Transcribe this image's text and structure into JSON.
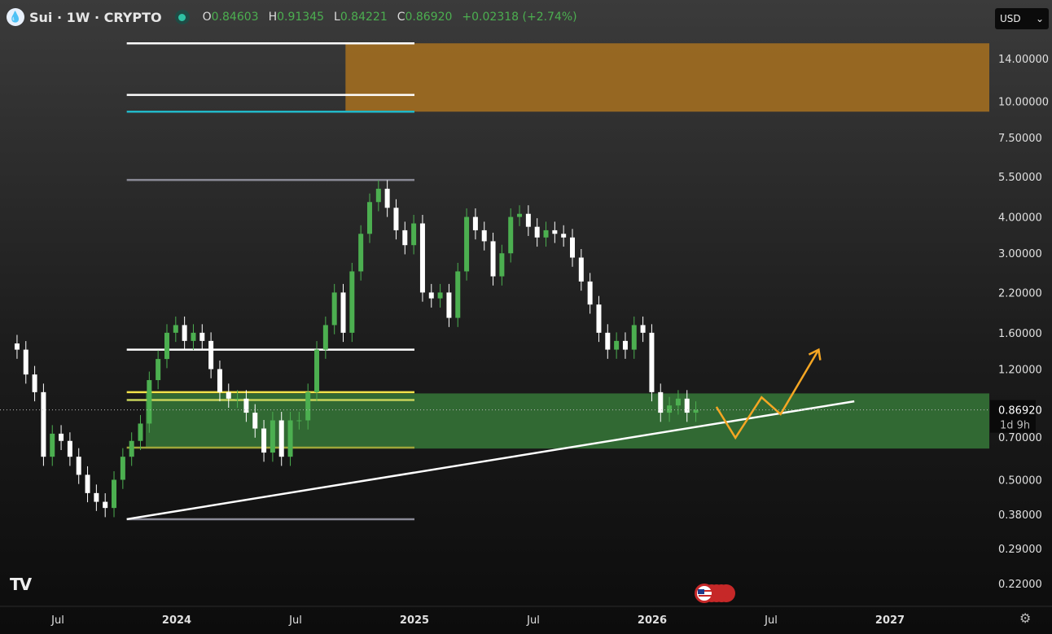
{
  "header": {
    "symbol": "Sui · 1W · CRYPTO",
    "o_label": "O",
    "o": "0.84603",
    "h_label": "H",
    "h": "0.91345",
    "l_label": "L",
    "l": "0.84221",
    "c_label": "C",
    "c": "0.86920",
    "change": "+0.02318 (+2.74%)"
  },
  "currency": {
    "label": "USD",
    "chevron": "⌄"
  },
  "price_label": {
    "value": "0.86920",
    "countdown": "1d 9h"
  },
  "colors": {
    "up": "#4caf50",
    "down": "#ffffff",
    "orange_zone": "#9c6a22",
    "green_zone": "#336e35",
    "projection": "#f5a623"
  },
  "chart_data": {
    "type": "candlestick",
    "scale": "log",
    "start": "2023-05-01",
    "end": "2026-03-09",
    "closes": [
      1.4,
      1.15,
      1.0,
      0.6,
      0.72,
      0.68,
      0.6,
      0.52,
      0.45,
      0.42,
      0.4,
      0.5,
      0.6,
      0.68,
      0.78,
      1.1,
      1.3,
      1.6,
      1.7,
      1.5,
      1.6,
      1.5,
      1.2,
      1.0,
      0.95,
      0.95,
      0.85,
      0.75,
      0.62,
      0.8,
      0.6,
      0.8,
      0.8,
      1.0,
      1.4,
      1.7,
      2.2,
      1.6,
      2.6,
      3.5,
      4.5,
      5.0,
      4.3,
      3.6,
      3.2,
      3.8,
      2.2,
      2.1,
      2.2,
      1.8,
      2.6,
      4.0,
      3.6,
      3.3,
      2.5,
      3.0,
      4.0,
      4.1,
      3.7,
      3.4,
      3.6,
      3.5,
      3.4,
      2.9,
      2.4,
      2.0,
      1.6,
      1.4,
      1.5,
      1.4,
      1.7,
      1.6,
      1.0,
      0.85,
      0.9,
      0.95,
      0.85,
      0.8692
    ],
    "y_ticks": [
      "14.00000",
      "10.00000",
      "7.50000",
      "5.50000",
      "4.00000",
      "3.00000",
      "2.20000",
      "1.60000",
      "1.20000",
      "0.70000",
      "0.50000",
      "0.38000",
      "0.29000",
      "0.22000"
    ],
    "x_ticks": [
      {
        "label": "Jul",
        "t": 2023.5
      },
      {
        "label": "2024",
        "t": 2024.0
      },
      {
        "label": "Jul",
        "t": 2024.5
      },
      {
        "label": "2025",
        "t": 2025.0
      },
      {
        "label": "Jul",
        "t": 2025.5
      },
      {
        "label": "2026",
        "t": 2026.0
      },
      {
        "label": "Jul",
        "t": 2026.5
      },
      {
        "label": "2027",
        "t": 2027.0
      }
    ],
    "levels": [
      {
        "price": 15.8,
        "color": "#ffffff"
      },
      {
        "price": 10.5,
        "color": "#ffffff"
      },
      {
        "price": 9.2,
        "color": "#22b8c8"
      },
      {
        "price": 5.36,
        "color": "#8a8a96"
      },
      {
        "price": 1.4,
        "color": "#ffffff"
      },
      {
        "price": 1.0,
        "color": "#f2e14a"
      },
      {
        "price": 0.94,
        "color": "#c8d25a"
      },
      {
        "price": 0.645,
        "color": "#9ea53a"
      },
      {
        "price": 0.366,
        "color": "#8a8a96"
      }
    ],
    "levels_range": [
      2023.79,
      2025.0
    ],
    "zones": [
      {
        "name": "orange-zone",
        "from": 2024.71,
        "top": 15.8,
        "bottom": 9.2,
        "color": "#9c6a22"
      },
      {
        "name": "green-zone",
        "from": 2023.87,
        "top": 0.99,
        "bottom": 0.64,
        "color": "#336e35"
      }
    ],
    "trendline": {
      "t": [
        2023.79,
        2026.85
      ],
      "price": [
        0.366,
        0.93
      ]
    },
    "projection": {
      "t": [
        2026.27,
        2026.35,
        2026.46,
        2026.54,
        2026.7
      ],
      "price": [
        0.89,
        0.697,
        0.96,
        0.84,
        1.4
      ]
    }
  }
}
